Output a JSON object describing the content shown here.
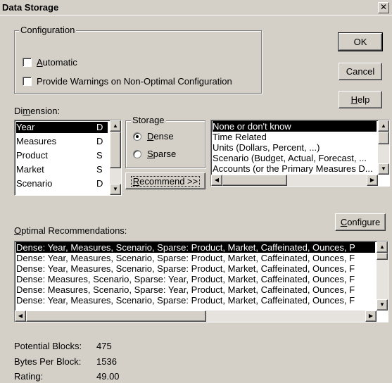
{
  "window": {
    "title": "Data Storage",
    "close_glyph": "✕"
  },
  "configuration": {
    "group_label": "Configuration",
    "automatic_label": "Automatic",
    "automatic_checked": false,
    "warnings_label": "Provide Warnings on Non-Optimal Configuration",
    "warnings_checked": false
  },
  "buttons": {
    "ok": "OK",
    "cancel": "Cancel",
    "help": "Help",
    "recommend": "Recommend >>",
    "configure": "Configure"
  },
  "dimension": {
    "label": "Dimension:",
    "items": [
      {
        "name": "Year",
        "code": "D",
        "selected": true
      },
      {
        "name": "Measures",
        "code": "D",
        "selected": false
      },
      {
        "name": "Product",
        "code": "S",
        "selected": false
      },
      {
        "name": "Market",
        "code": "S",
        "selected": false
      },
      {
        "name": "Scenario",
        "code": "D",
        "selected": false
      }
    ]
  },
  "storage": {
    "group_label": "Storage",
    "dense_label": "Dense",
    "sparse_label": "Sparse",
    "selected": "Dense"
  },
  "type_list": {
    "items": [
      {
        "text": "None or don't know",
        "selected": true
      },
      {
        "text": "Time Related",
        "selected": false
      },
      {
        "text": "Units (Dollars, Percent, ...)",
        "selected": false
      },
      {
        "text": "Scenario (Budget, Actual, Forecast, ...",
        "selected": false
      },
      {
        "text": "Accounts (or the Primary Measures D...",
        "selected": false
      }
    ]
  },
  "recommendations": {
    "label": "Optimal Recommendations:",
    "items": [
      {
        "text": "Dense: Year, Measures, Scenario, Sparse: Product, Market, Caffeinated, Ounces, P",
        "selected": true
      },
      {
        "text": "Dense: Year, Measures, Scenario, Sparse: Product, Market, Caffeinated, Ounces, F",
        "selected": false
      },
      {
        "text": "Dense: Year, Measures, Scenario, Sparse: Product, Market, Caffeinated, Ounces, F",
        "selected": false
      },
      {
        "text": "Dense: Measures, Scenario, Sparse: Year, Product, Market, Caffeinated, Ounces, F",
        "selected": false
      },
      {
        "text": "Dense: Measures, Scenario, Sparse: Year, Product, Market, Caffeinated, Ounces, F",
        "selected": false
      },
      {
        "text": "Dense: Year, Measures, Scenario, Sparse: Product, Market, Caffeinated, Ounces, F",
        "selected": false
      }
    ]
  },
  "stats": {
    "potential_blocks_label": "Potential Blocks:",
    "potential_blocks": "475",
    "bytes_per_block_label": "Bytes Per Block:",
    "bytes_per_block": "1536",
    "rating_label": "Rating:",
    "rating": "49.00"
  }
}
